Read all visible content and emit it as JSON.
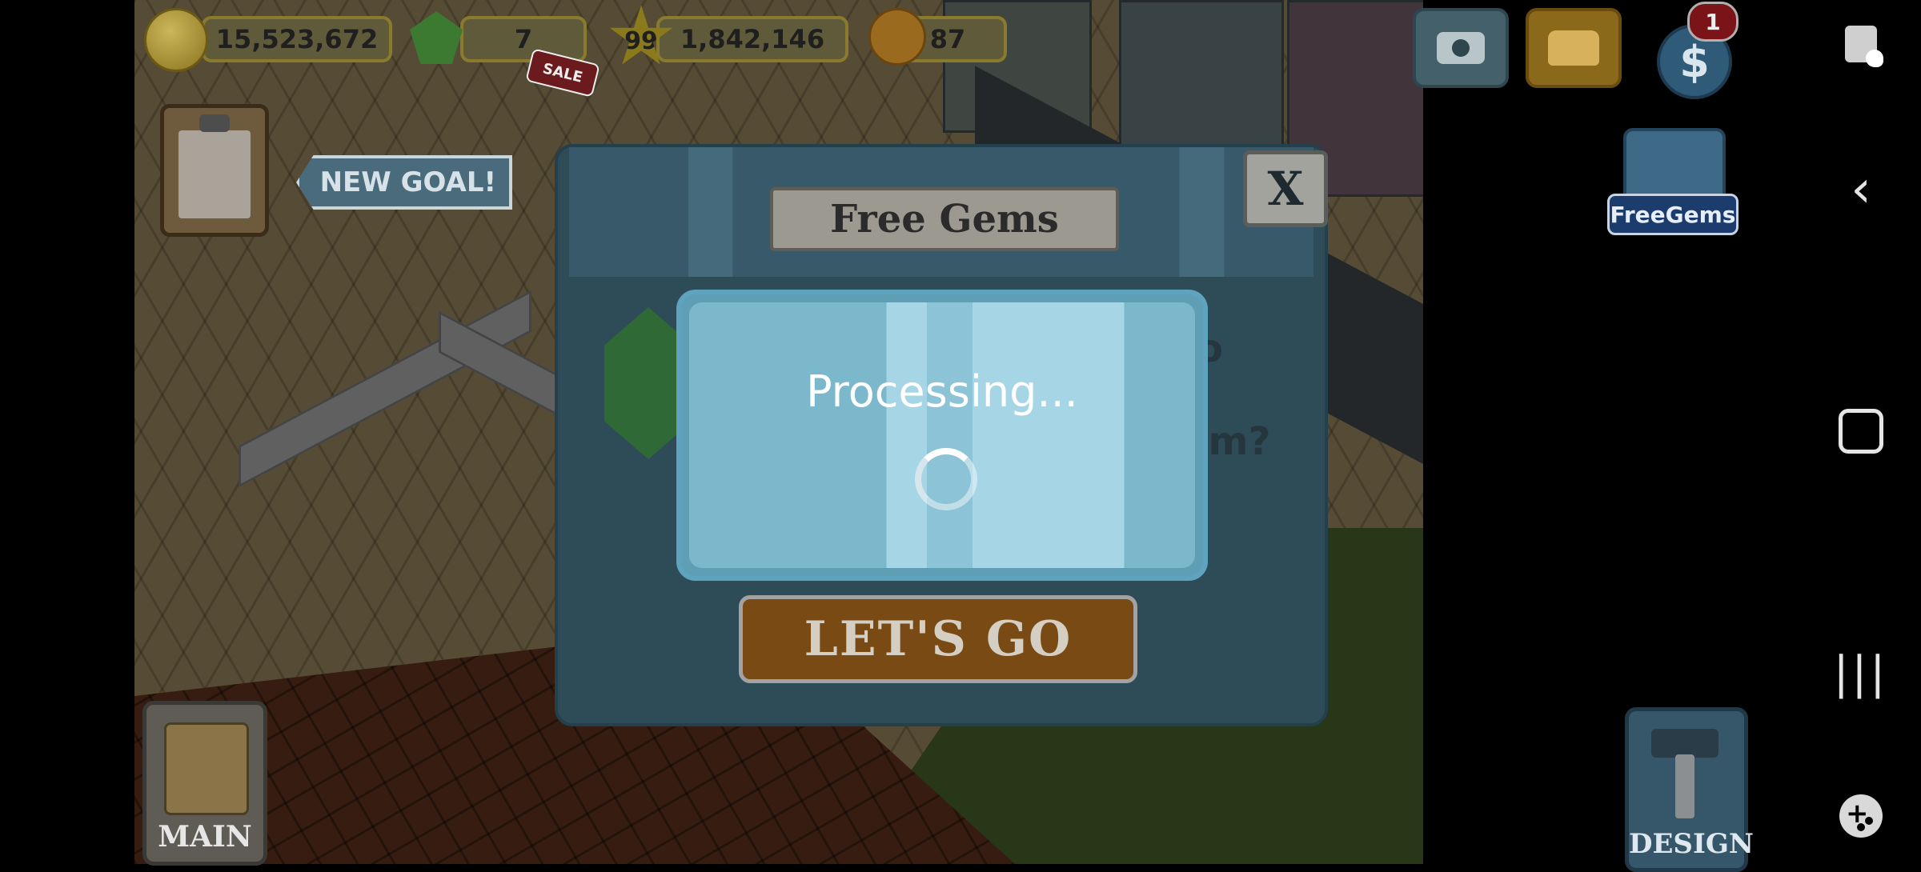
{
  "hud": {
    "coins": "15,523,672",
    "gems": "7",
    "level": "99",
    "xp": "1,842,146",
    "fans": "87",
    "sale_tag": "SALE",
    "notification_count": "1",
    "money_symbol": "$"
  },
  "buttons": {
    "new_goal": "NEW GOAL!",
    "free_gems": "FreeGems",
    "main": "MAIN",
    "design": "DESIGN"
  },
  "dialog": {
    "title": "Free Gems",
    "close_label": "X",
    "question_fragment_1": "o",
    "question_fragment_2": "em?",
    "lets_go": "LET'S GO"
  },
  "processing": {
    "text": "Processing..."
  },
  "system_nav": {
    "back_glyph": "‹",
    "recents_glyph": "|||"
  }
}
